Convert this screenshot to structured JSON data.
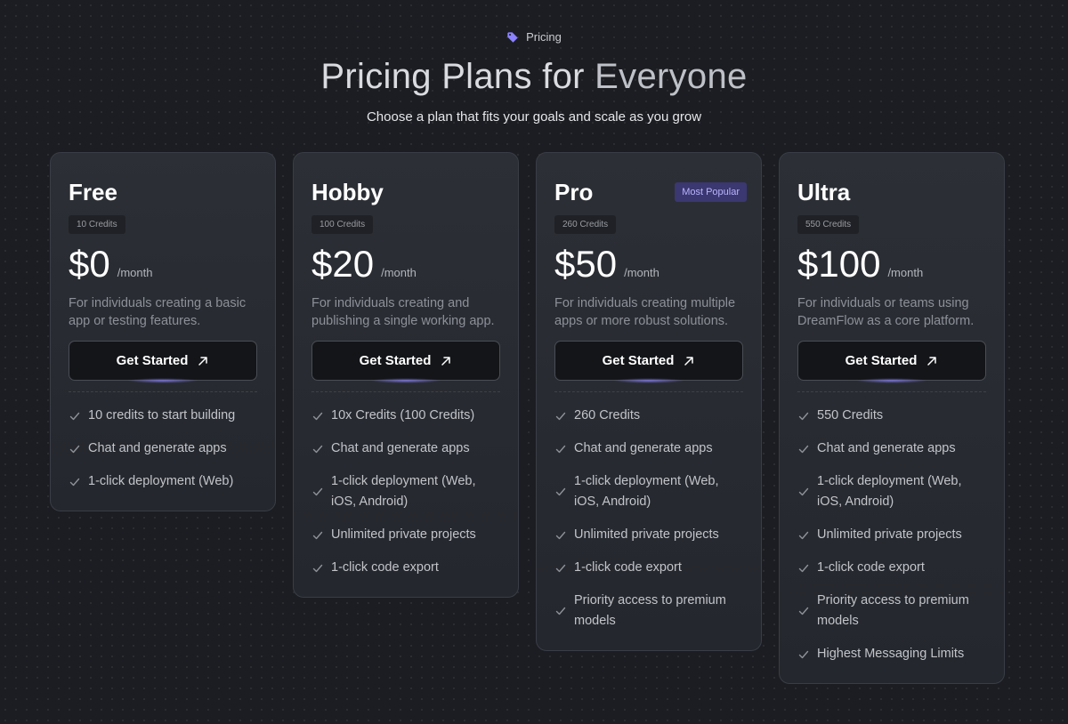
{
  "header": {
    "eyebrow_label": "Pricing",
    "title_main": "Pricing Plans for ",
    "title_accent": "Everyone",
    "subtitle": "Choose a plan that fits your goals and scale as you grow"
  },
  "colors": {
    "background": "#1b1d22",
    "card": "#2a2d33",
    "accent": "#8c82ff",
    "badge_bg": "#3b3770",
    "badge_text": "#b9b4ff"
  },
  "icons": {
    "eyebrow": "tag-icon",
    "cta": "arrow-up-right-icon",
    "feature": "check-icon"
  },
  "plans": [
    {
      "name": "Free",
      "credits": "10 Credits",
      "price": "$0",
      "period": "/month",
      "description": "For individuals creating a basic app or testing features.",
      "cta": "Get Started",
      "badge": "",
      "features": [
        "10 credits to start building",
        "Chat and generate apps",
        "1-click deployment (Web)"
      ]
    },
    {
      "name": "Hobby",
      "credits": "100 Credits",
      "price": "$20",
      "period": "/month",
      "description": "For individuals creating and publishing a single working app.",
      "cta": "Get Started",
      "badge": "",
      "features": [
        "10x Credits (100 Credits)",
        "Chat and generate apps",
        "1-click deployment (Web, iOS, Android)",
        "Unlimited private projects",
        "1-click code export"
      ]
    },
    {
      "name": "Pro",
      "credits": "260 Credits",
      "price": "$50",
      "period": "/month",
      "description": "For individuals creating multiple apps or more robust solutions.",
      "cta": "Get Started",
      "badge": "Most Popular",
      "features": [
        "260 Credits",
        "Chat and generate apps",
        "1-click deployment (Web, iOS, Android)",
        "Unlimited private projects",
        "1-click code export",
        "Priority access to premium models"
      ]
    },
    {
      "name": "Ultra",
      "credits": "550 Credits",
      "price": "$100",
      "period": "/month",
      "description": "For individuals or teams using DreamFlow as a core platform.",
      "cta": "Get Started",
      "badge": "",
      "features": [
        "550 Credits",
        "Chat and generate apps",
        "1-click deployment (Web, iOS, Android)",
        "Unlimited private projects",
        "1-click code export",
        "Priority access to premium models",
        "Highest Messaging Limits"
      ]
    }
  ]
}
